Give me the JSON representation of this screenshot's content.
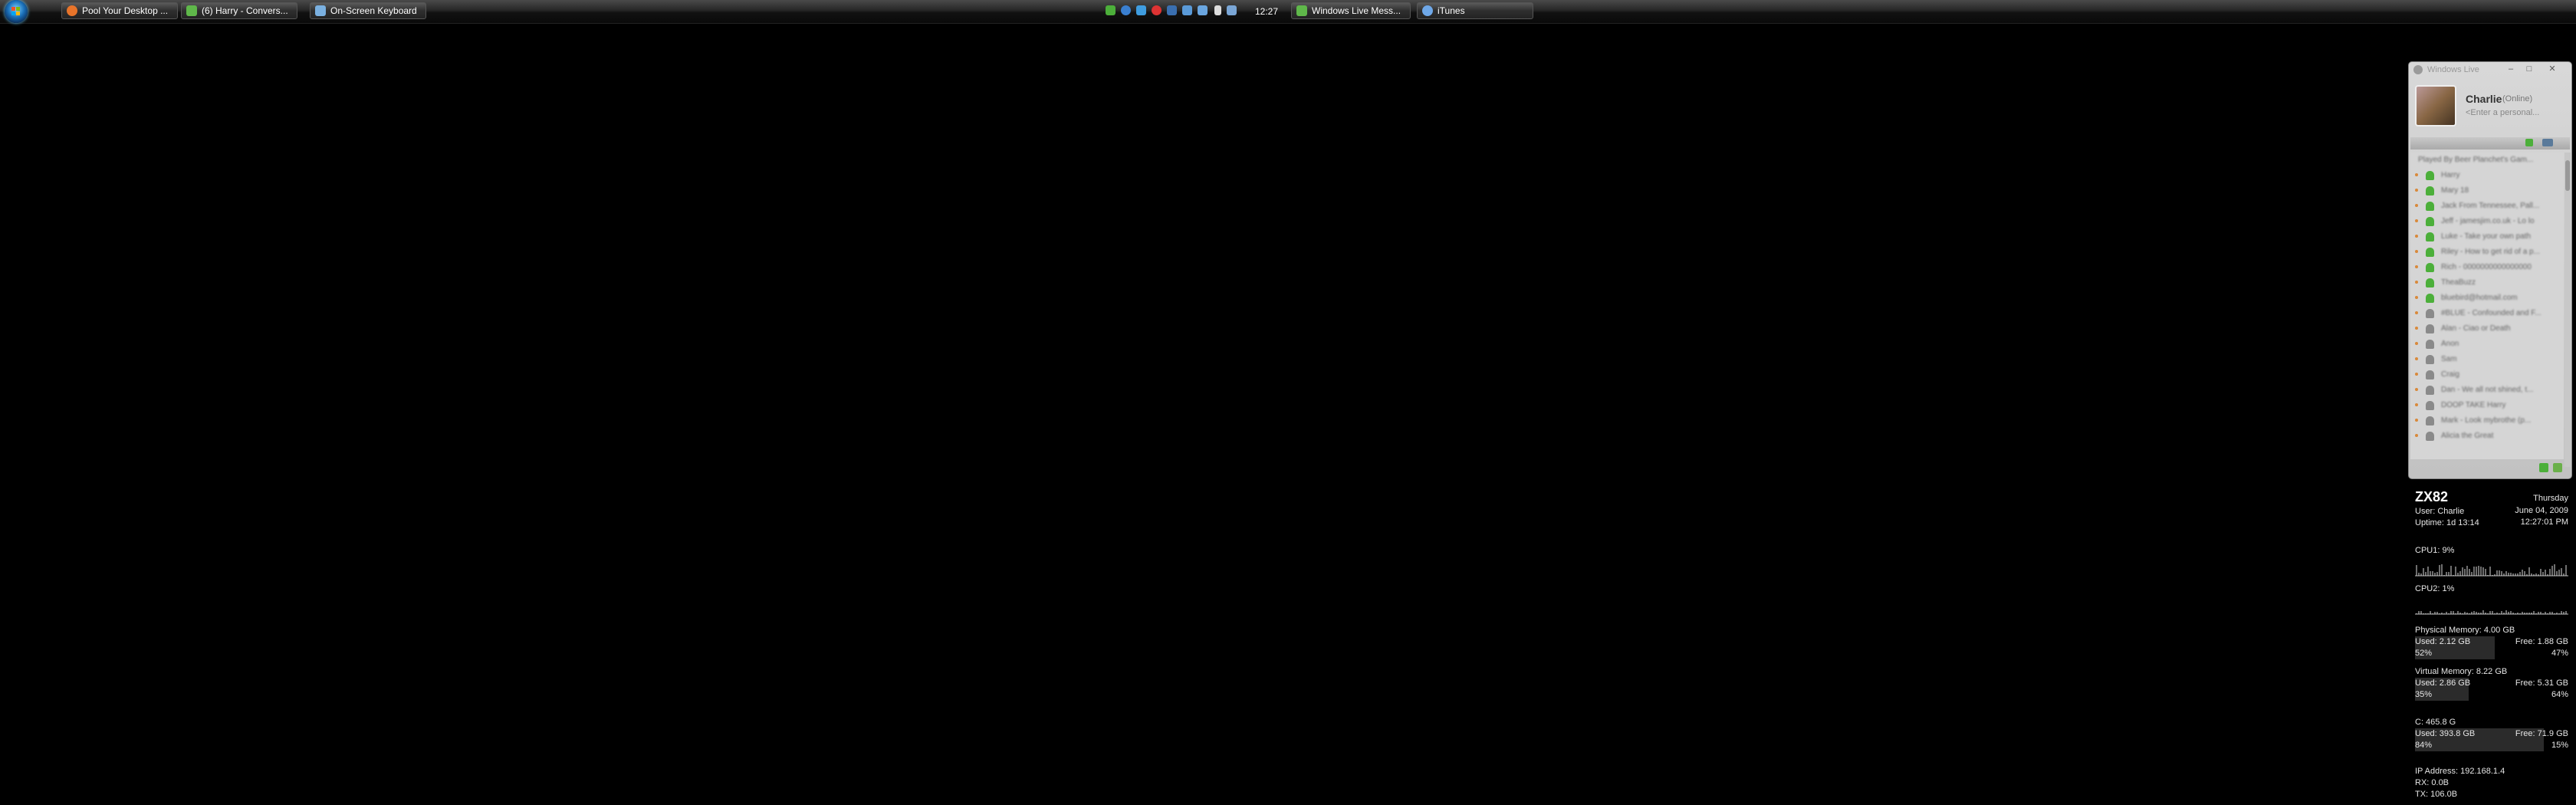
{
  "taskbar": {
    "buttons": [
      {
        "label": "Pool Your Desktop ...",
        "icon": "firefox-icon",
        "color": "#e8742a"
      },
      {
        "label": "(6) Harry - Convers...",
        "icon": "messenger-conversation-icon",
        "color": "#5fb84a"
      },
      {
        "label": "On-Screen Keyboard",
        "icon": "keyboard-icon",
        "color": "#7ab0e0"
      },
      {
        "label": "Windows Live Mess...",
        "icon": "messenger-icon",
        "color": "#5fb84a"
      },
      {
        "label": "iTunes",
        "icon": "itunes-icon",
        "color": "#6fa8e8"
      }
    ],
    "tray_icons": [
      "messenger-tray-icon",
      "globe-icon",
      "shield-icon",
      "warning-icon",
      "info-icon",
      "network-icon",
      "display-icon",
      "volume-icon",
      "network-status-icon"
    ],
    "clock": "12:27"
  },
  "messenger": {
    "title": "Windows Live",
    "user": {
      "name": "Charlie",
      "status": "(Online)",
      "personal_message": "<Enter a personal..."
    },
    "contacts": [
      {
        "text": "Played By Beer Planchet's Gam...",
        "status": "group"
      },
      {
        "text": "Harry",
        "status": "online"
      },
      {
        "text": "Mary 18",
        "status": "online"
      },
      {
        "text": "Jack From Tennessee, Pall...",
        "status": "online"
      },
      {
        "text": "Jeff - jamesjim.co.uk - Lo lo",
        "status": "online"
      },
      {
        "text": "Luke - Take your own path",
        "status": "online"
      },
      {
        "text": "Riley - How to get rid of a p...",
        "status": "online"
      },
      {
        "text": "Rich - 0000000000000000",
        "status": "online"
      },
      {
        "text": "TheaBuzz",
        "status": "online"
      },
      {
        "text": "bluebird@hotmail.com",
        "status": "online"
      },
      {
        "text": "#BLUE - Confounded and F...",
        "status": "offline"
      },
      {
        "text": "Alan - Ciao or Death",
        "status": "offline"
      },
      {
        "text": "Anon",
        "status": "offline"
      },
      {
        "text": "Sam",
        "status": "offline"
      },
      {
        "text": "Craig",
        "status": "offline"
      },
      {
        "text": "Dan - We all not shined, t...",
        "status": "offline"
      },
      {
        "text": "DOOP TAKE Harry",
        "status": "offline"
      },
      {
        "text": "Mark - Look mybrothe (p...",
        "status": "offline"
      },
      {
        "text": "Alicia the Great",
        "status": "offline"
      }
    ],
    "colors": {
      "online": "#4caf3a",
      "offline": "#8a8a8a"
    }
  },
  "system": {
    "computer_name": "ZX82",
    "user": "User: Charlie",
    "uptime": "Uptime: 1d 13:14",
    "day": "Thursday",
    "date": "June 04, 2009",
    "time": "12:27:01 PM",
    "cpu1": {
      "label": "CPU1: 9%",
      "percent": 9
    },
    "cpu2": {
      "label": "CPU2: 1%",
      "percent": 1
    },
    "physical_memory": {
      "title": "Physical Memory: 4.00 GB",
      "used": "Used: 2.12 GB",
      "free": "Free: 1.88 GB",
      "used_pct": "52%",
      "free_pct": "47%",
      "fraction": 0.52
    },
    "virtual_memory": {
      "title": "Virtual Memory: 8.22 GB",
      "used": "Used: 2.86 GB",
      "free": "Free: 5.31 GB",
      "used_pct": "35%",
      "free_pct": "64%",
      "fraction": 0.35
    },
    "drive_c": {
      "title": "C: 465.8 G",
      "used": "Used: 393.8 GB",
      "free": "Free: 71.9 GB",
      "used_pct": "84%",
      "free_pct": "15%",
      "fraction": 0.84
    },
    "network": {
      "ip": "IP Address: 192.168.1.4",
      "rx": "RX: 0.0B",
      "tx": "TX: 106.0B"
    }
  }
}
